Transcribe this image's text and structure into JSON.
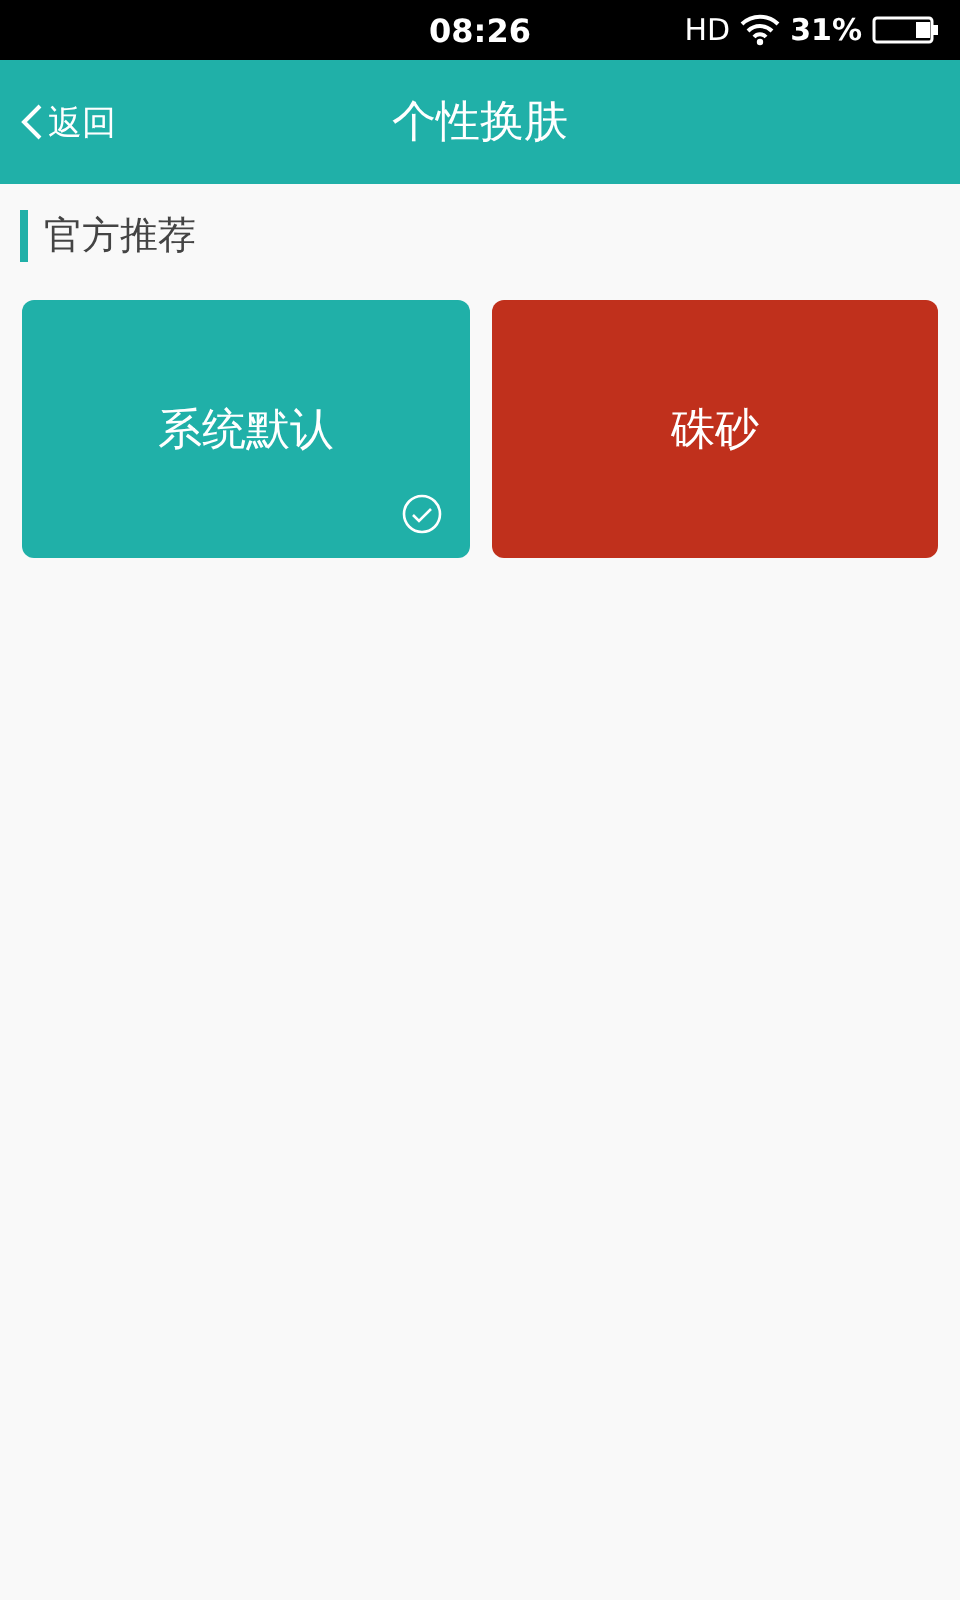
{
  "status_bar": {
    "time": "08:26",
    "network": "HD",
    "battery": "31%"
  },
  "header": {
    "back": "返回",
    "title": "个性换肤"
  },
  "section": {
    "title": "官方推荐"
  },
  "skins": [
    {
      "name": "系统默认",
      "color": "#20b0a8",
      "selected": true
    },
    {
      "name": "硃砂",
      "color": "#c0301c",
      "selected": false
    }
  ]
}
